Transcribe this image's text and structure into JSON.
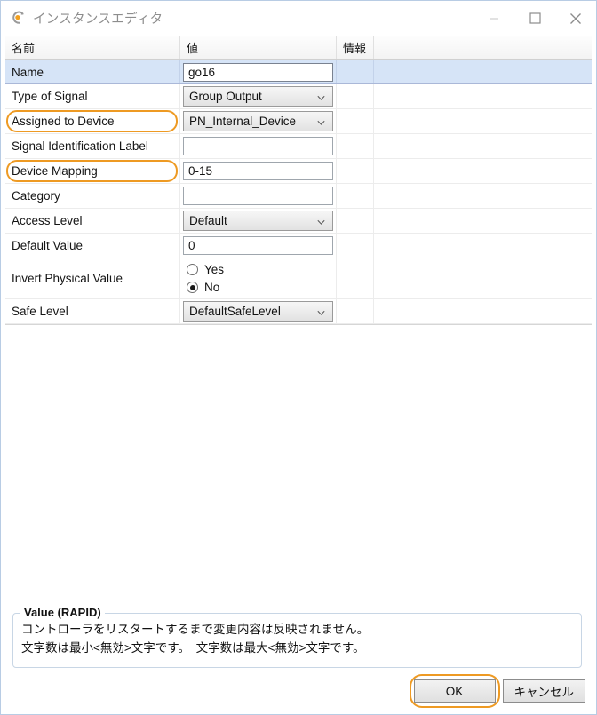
{
  "window": {
    "title": "インスタンスエディタ",
    "icon": "instance-editor-icon",
    "controls": {
      "minimize": "minimize-icon",
      "maximize": "maximize-icon",
      "close": "close-icon"
    }
  },
  "grid": {
    "headers": {
      "name": "名前",
      "value": "値",
      "info": "情報",
      "extra": ""
    },
    "rows": [
      {
        "label": "Name",
        "type": "textbox",
        "value": "go16",
        "selected": true,
        "highlight": false
      },
      {
        "label": "Type of Signal",
        "type": "combo",
        "value": "Group Output",
        "selected": false,
        "highlight": false
      },
      {
        "label": "Assigned to Device",
        "type": "combo",
        "value": "PN_Internal_Device",
        "selected": false,
        "highlight": true
      },
      {
        "label": "Signal Identification Label",
        "type": "textbox",
        "value": "",
        "selected": false,
        "highlight": false
      },
      {
        "label": "Device Mapping",
        "type": "textbox",
        "value": "0-15",
        "selected": false,
        "highlight": true
      },
      {
        "label": "Category",
        "type": "textbox",
        "value": "",
        "selected": false,
        "highlight": false
      },
      {
        "label": "Access Level",
        "type": "combo",
        "value": "Default",
        "selected": false,
        "highlight": false
      },
      {
        "label": "Default Value",
        "type": "textbox",
        "value": "0",
        "selected": false,
        "highlight": false
      },
      {
        "label": "Invert Physical Value",
        "type": "radio",
        "options": [
          {
            "label": "Yes",
            "checked": false
          },
          {
            "label": "No",
            "checked": true
          }
        ],
        "selected": false,
        "highlight": false
      },
      {
        "label": "Safe Level",
        "type": "combo",
        "value": "DefaultSafeLevel",
        "selected": false,
        "highlight": false
      }
    ]
  },
  "info_panel": {
    "legend": "Value (RAPID)",
    "line1": "コントローラをリスタートするまで変更内容は反映されません。",
    "line2": "文字数は最小<無効>文字です。　文字数は最大<無効>文字です。"
  },
  "footer": {
    "ok_label": "OK",
    "cancel_label": "キャンセル"
  },
  "colors": {
    "focus_ring_orange": "#EE9A23",
    "selected_row_blue": "#D6E4F7",
    "title_gray": "#8D8D8D",
    "groupbox_border": "#C8D6E5"
  }
}
